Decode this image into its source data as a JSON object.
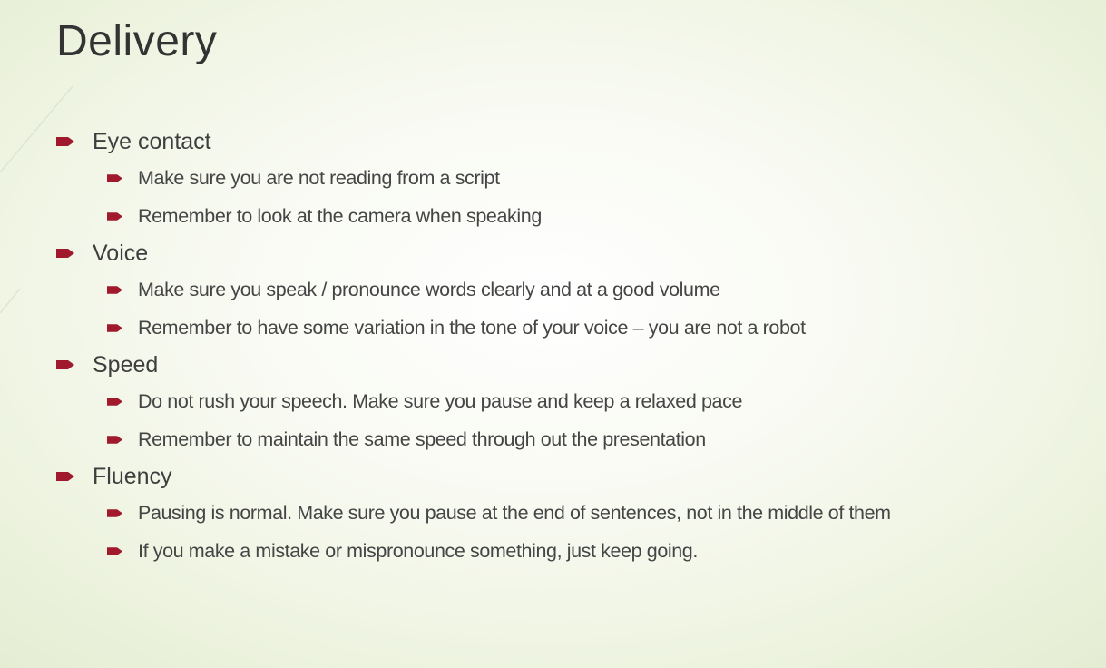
{
  "slide": {
    "title": "Delivery",
    "accent_color": "#a0192d",
    "bullet_icon": "arrow-bullet-icon",
    "sections": [
      {
        "label": "Eye contact",
        "items": [
          "Make sure you are not reading from a script",
          "Remember to look at the camera when speaking"
        ]
      },
      {
        "label": "Voice",
        "items": [
          "Make sure you speak / pronounce words clearly and at a good volume",
          "Remember to have some variation in the tone of your voice – you are not a robot"
        ]
      },
      {
        "label": "Speed",
        "items": [
          "Do not rush your speech. Make sure you pause and keep a relaxed pace",
          "Remember to maintain the same speed through out the presentation"
        ]
      },
      {
        "label": "Fluency",
        "items": [
          "Pausing is normal. Make sure you pause at the end of sentences, not in the middle of them",
          "If you make a mistake or mispronounce something, just keep going."
        ]
      }
    ]
  }
}
